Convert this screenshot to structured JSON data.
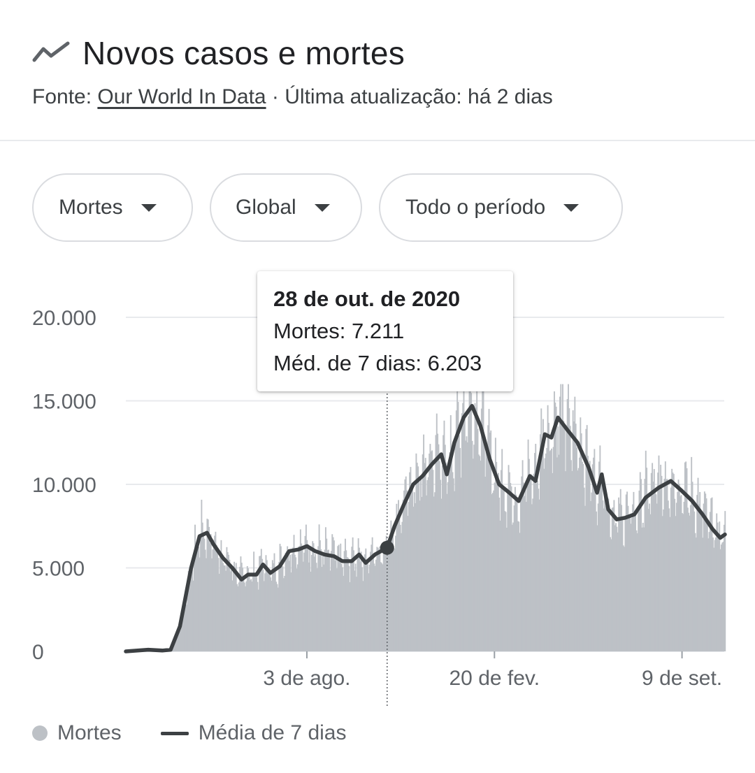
{
  "header": {
    "title": "Novos casos e mortes",
    "source_prefix": "Fonte: ",
    "source_link": "Our World In Data",
    "source_suffix": " · Última atualização: há 2 dias"
  },
  "filters": [
    {
      "label": "Mortes"
    },
    {
      "label": "Global"
    },
    {
      "label": "Todo o período"
    }
  ],
  "tooltip": {
    "date": "28 de out. de 2020",
    "deaths": "Mortes: 7.211",
    "avg": "Méd. de 7 dias: 6.203"
  },
  "legend": {
    "bars": "Mortes",
    "line": "Média de 7 dias"
  },
  "colors": {
    "bars": "#bdc1c6",
    "line": "#3c4043",
    "grid": "#e8eaed",
    "axis_text": "#5f6368"
  },
  "chart_data": {
    "type": "bar",
    "y_ticks": [
      {
        "value": 0,
        "label": "0"
      },
      {
        "value": 5000,
        "label": "5.000"
      },
      {
        "value": 10000,
        "label": "10.000"
      },
      {
        "value": 15000,
        "label": "15.000"
      },
      {
        "value": 20000,
        "label": "20.000"
      }
    ],
    "ylim": [
      0,
      20000
    ],
    "x_ticks": [
      {
        "date": "2020-08-03",
        "label": "3 de ago."
      },
      {
        "date": "2021-02-20",
        "label": "20 de fev."
      },
      {
        "date": "2021-09-09",
        "label": "9 de set."
      }
    ],
    "x_range": [
      "2020-01-22",
      "2021-10-25"
    ],
    "bars_start": "2020-03-10",
    "highlight": {
      "date": "2020-10-28",
      "value": 7211,
      "avg": 6203
    },
    "series": [
      {
        "name": "Média de 7 dias",
        "type": "line",
        "points": [
          [
            "2020-01-22",
            0
          ],
          [
            "2020-02-15",
            100
          ],
          [
            "2020-03-01",
            50
          ],
          [
            "2020-03-10",
            100
          ],
          [
            "2020-03-20",
            1500
          ],
          [
            "2020-04-01",
            5000
          ],
          [
            "2020-04-10",
            6900
          ],
          [
            "2020-04-18",
            7100
          ],
          [
            "2020-04-25",
            6400
          ],
          [
            "2020-05-05",
            5600
          ],
          [
            "2020-05-15",
            5000
          ],
          [
            "2020-05-25",
            4300
          ],
          [
            "2020-06-01",
            4600
          ],
          [
            "2020-06-10",
            4600
          ],
          [
            "2020-06-17",
            5200
          ],
          [
            "2020-06-25",
            4700
          ],
          [
            "2020-07-05",
            5100
          ],
          [
            "2020-07-15",
            6000
          ],
          [
            "2020-07-25",
            6100
          ],
          [
            "2020-08-03",
            6300
          ],
          [
            "2020-08-12",
            6000
          ],
          [
            "2020-08-22",
            5800
          ],
          [
            "2020-09-01",
            5700
          ],
          [
            "2020-09-10",
            5400
          ],
          [
            "2020-09-20",
            5400
          ],
          [
            "2020-09-28",
            5800
          ],
          [
            "2020-10-05",
            5300
          ],
          [
            "2020-10-15",
            5800
          ],
          [
            "2020-10-28",
            6203
          ],
          [
            "2020-11-05",
            7500
          ],
          [
            "2020-11-15",
            8800
          ],
          [
            "2020-11-25",
            10000
          ],
          [
            "2020-12-05",
            10500
          ],
          [
            "2020-12-15",
            11200
          ],
          [
            "2020-12-25",
            11800
          ],
          [
            "2020-12-31",
            10600
          ],
          [
            "2021-01-08",
            12500
          ],
          [
            "2021-01-18",
            14000
          ],
          [
            "2021-01-27",
            14700
          ],
          [
            "2021-02-05",
            13500
          ],
          [
            "2021-02-15",
            11500
          ],
          [
            "2021-02-25",
            10000
          ],
          [
            "2021-03-08",
            9500
          ],
          [
            "2021-03-18",
            9000
          ],
          [
            "2021-03-30",
            10500
          ],
          [
            "2021-04-05",
            10200
          ],
          [
            "2021-04-15",
            13000
          ],
          [
            "2021-04-22",
            12800
          ],
          [
            "2021-04-29",
            14000
          ],
          [
            "2021-05-10",
            13200
          ],
          [
            "2021-05-20",
            12500
          ],
          [
            "2021-06-01",
            11000
          ],
          [
            "2021-06-10",
            9500
          ],
          [
            "2021-06-15",
            10600
          ],
          [
            "2021-06-22",
            8500
          ],
          [
            "2021-07-01",
            7900
          ],
          [
            "2021-07-10",
            8000
          ],
          [
            "2021-07-20",
            8200
          ],
          [
            "2021-08-01",
            9200
          ],
          [
            "2021-08-15",
            9800
          ],
          [
            "2021-08-28",
            10200
          ],
          [
            "2021-09-09",
            9600
          ],
          [
            "2021-09-20",
            9000
          ],
          [
            "2021-10-01",
            8200
          ],
          [
            "2021-10-12",
            7300
          ],
          [
            "2021-10-20",
            6800
          ],
          [
            "2021-10-25",
            7000
          ]
        ]
      }
    ]
  }
}
